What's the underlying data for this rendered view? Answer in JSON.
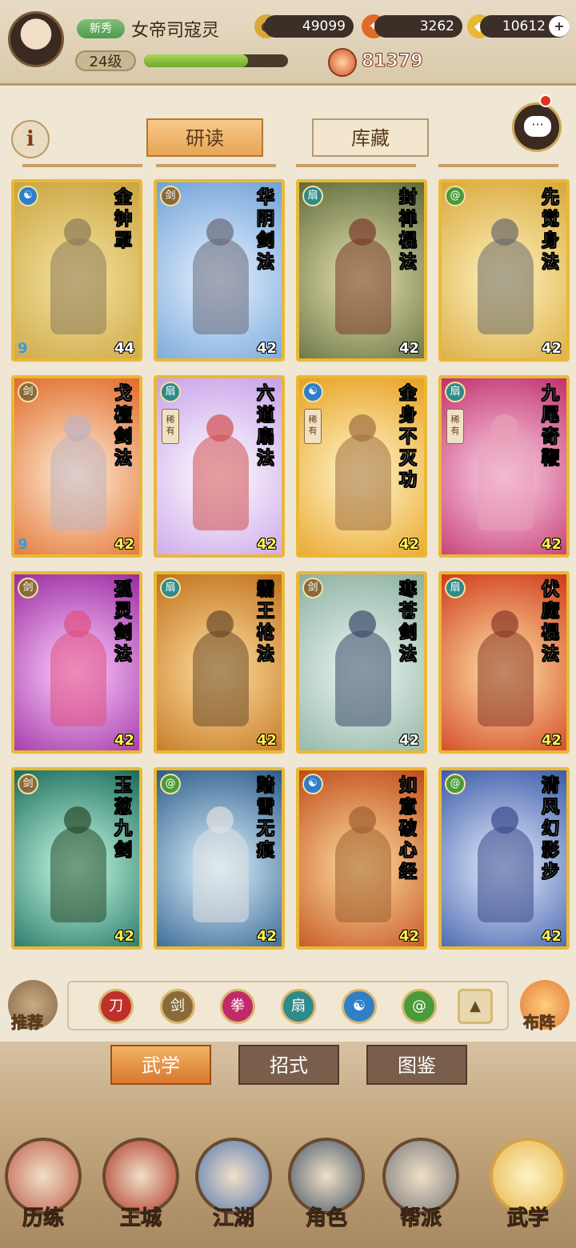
{
  "player": {
    "rank_badge": "新秀",
    "name": "女帝司寇灵",
    "level": "24级",
    "exp_fraction": 0.72
  },
  "resources": {
    "coins": "49099",
    "gems": "3262",
    "ingots": "10612",
    "power": "81379",
    "add_icon": "plus-icon"
  },
  "header": {
    "info": "i",
    "tabs": [
      "研读",
      "库藏"
    ]
  },
  "cards": [
    {
      "title": "金钟罩",
      "level": "44",
      "school": "taiji",
      "school_color": "#2f7fc8",
      "rare": false,
      "corner": "9",
      "bg": [
        "#f6e3a0",
        "#c9a440"
      ],
      "level_color": "#ffffff",
      "figure": "#8a7a5a"
    },
    {
      "title": "华阴剑法",
      "level": "42",
      "school": "sword",
      "school_color": "#8a6a3a",
      "rare": false,
      "corner": "",
      "bg": [
        "#e8f2ff",
        "#6fa2d8"
      ],
      "level_color": "#ffffff",
      "figure": "#6a6a7a"
    },
    {
      "title": "封禅棍法",
      "level": "42",
      "school": "fan",
      "school_color": "#2f8a8a",
      "rare": false,
      "corner": "",
      "bg": [
        "#e8e2b0",
        "#5e6a3a"
      ],
      "level_color": "#ffffff",
      "figure": "#7a3a2a"
    },
    {
      "title": "先觉身法",
      "level": "42",
      "school": "spiral",
      "school_color": "#4a9a3a",
      "rare": false,
      "corner": "",
      "bg": [
        "#fff3c0",
        "#d8a83a"
      ],
      "level_color": "#ffffff",
      "figure": "#6a6a6a"
    },
    {
      "title": "戈檀剑法",
      "level": "42",
      "school": "sword",
      "school_color": "#8a6a3a",
      "rare": false,
      "corner": "9",
      "bg": [
        "#fff0d8",
        "#e06a2a"
      ],
      "level_color": "#fff14a",
      "figure": "#c0b0c0"
    },
    {
      "title": "六道扇法",
      "level": "42",
      "school": "fan",
      "school_color": "#2f8a8a",
      "rare": true,
      "rare_text": "稀有",
      "corner": "",
      "bg": [
        "#ffffff",
        "#c8a0e8"
      ],
      "level_color": "#fff14a",
      "figure": "#d05050"
    },
    {
      "title": "金身不灭功",
      "level": "42",
      "school": "taiji",
      "school_color": "#2f7fc8",
      "rare": true,
      "rare_text": "稀有",
      "corner": "",
      "bg": [
        "#fff8d0",
        "#e8a020"
      ],
      "level_color": "#fff14a",
      "figure": "#a07040"
    },
    {
      "title": "九尾奇鞭",
      "level": "42",
      "school": "fan",
      "school_color": "#2f8a8a",
      "rare": true,
      "rare_text": "稀有",
      "corner": "",
      "bg": [
        "#ffd8ec",
        "#c0306a"
      ],
      "level_color": "#fff14a",
      "figure": "#e8a0b8"
    },
    {
      "title": "孤灵剑法",
      "level": "42",
      "school": "sword",
      "school_color": "#8a6a3a",
      "rare": false,
      "corner": "",
      "bg": [
        "#ffd0ff",
        "#9a2aa0"
      ],
      "level_color": "#fff14a",
      "figure": "#e05080"
    },
    {
      "title": "霸王枪法",
      "level": "42",
      "school": "fan",
      "school_color": "#2f8a8a",
      "rare": false,
      "corner": "",
      "bg": [
        "#ffe0a0",
        "#c0701a"
      ],
      "level_color": "#fff14a",
      "figure": "#6a4a2a"
    },
    {
      "title": "寒苍剑法",
      "level": "42",
      "school": "sword",
      "school_color": "#8a6a3a",
      "rare": false,
      "corner": "",
      "bg": [
        "#eef6f2",
        "#8ab0a0"
      ],
      "level_color": "#ffffff",
      "figure": "#3a4a6a"
    },
    {
      "title": "伏魔棍法",
      "level": "42",
      "school": "fan",
      "school_color": "#2f8a8a",
      "rare": false,
      "corner": "",
      "bg": [
        "#ffe6a8",
        "#d03a1a"
      ],
      "level_color": "#fff14a",
      "figure": "#8a3a2a"
    },
    {
      "title": "玉葱九剑",
      "level": "42",
      "school": "sword",
      "school_color": "#8a6a3a",
      "rare": false,
      "corner": "",
      "bg": [
        "#c8ffe8",
        "#1a6a5a"
      ],
      "level_color": "#fff14a",
      "figure": "#2a4a2a"
    },
    {
      "title": "踏雪无痕",
      "level": "42",
      "school": "spiral",
      "school_color": "#4a9a3a",
      "rare": false,
      "corner": "",
      "bg": [
        "#e0f6ff",
        "#2a5a8a"
      ],
      "level_color": "#fff14a",
      "figure": "#e0e0e0"
    },
    {
      "title": "如意破心经",
      "level": "42",
      "school": "taiji",
      "school_color": "#2f7fc8",
      "rare": false,
      "corner": "",
      "bg": [
        "#ffe0a0",
        "#c04a1a"
      ],
      "level_color": "#fff14a",
      "figure": "#a06030"
    },
    {
      "title": "清风幻影步",
      "level": "42",
      "school": "spiral",
      "school_color": "#4a9a3a",
      "rare": false,
      "corner": "",
      "bg": [
        "#e8f0ff",
        "#3a5aa8"
      ],
      "level_color": "#fff14a",
      "figure": "#3a4a8a"
    }
  ],
  "filter": {
    "recommend": "推荐",
    "formation": "布阵",
    "icons": [
      {
        "name": "blade-school-icon",
        "color": "#c0302a",
        "glyph": "刀"
      },
      {
        "name": "sword-school-icon",
        "color": "#8a6a3a",
        "glyph": "剑"
      },
      {
        "name": "fist-school-icon",
        "color": "#c02a6a",
        "glyph": "拳"
      },
      {
        "name": "fan-school-icon",
        "color": "#2f8a8a",
        "glyph": "扇"
      },
      {
        "name": "taiji-school-icon",
        "color": "#2f7fc8",
        "glyph": "☯"
      },
      {
        "name": "spiral-school-icon",
        "color": "#4a9a3a",
        "glyph": "@"
      },
      {
        "name": "rank-up-icon",
        "color": "#e8d8b0",
        "glyph": "▲"
      }
    ]
  },
  "subtabs": [
    "武学",
    "招式",
    "图鉴"
  ],
  "nav": [
    "历练",
    "王城",
    "江湖",
    "角色",
    "帮派",
    "武学"
  ],
  "nav_colors": [
    "#c0604a",
    "#b03a2a",
    "#5a7ab0",
    "#4a5a6a",
    "#7a7a7a",
    "#e6b64a"
  ]
}
